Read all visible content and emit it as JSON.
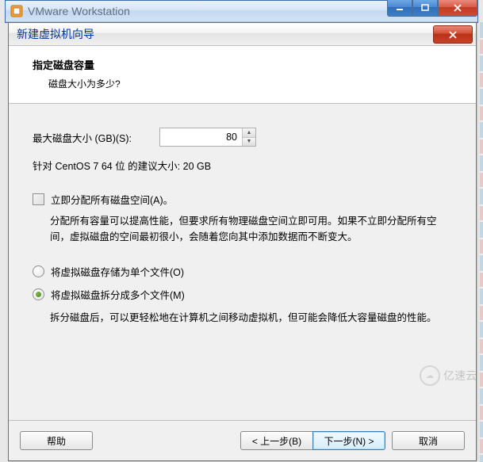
{
  "outer_window": {
    "title": "VMware Workstation"
  },
  "wizard": {
    "title": "新建虚拟机向导",
    "heading": "指定磁盘容量",
    "subheading": "磁盘大小为多少?"
  },
  "disk": {
    "label": "最大磁盘大小 (GB)(S):",
    "value": "80",
    "recommend": "针对 CentOS 7 64 位 的建议大小: 20 GB"
  },
  "allocate": {
    "checkbox_label": "立即分配所有磁盘空间(A)。",
    "checked": false,
    "desc": "分配所有容量可以提高性能，但要求所有物理磁盘空间立即可用。如果不立即分配所有空间，虚拟磁盘的空间最初很小，会随着您向其中添加数据而不断变大。"
  },
  "split": {
    "option_single": "将虚拟磁盘存储为单个文件(O)",
    "option_multi": "将虚拟磁盘拆分成多个文件(M)",
    "selected": "multi",
    "desc": "拆分磁盘后，可以更轻松地在计算机之间移动虚拟机，但可能会降低大容量磁盘的性能。"
  },
  "buttons": {
    "help": "帮助",
    "back": "< 上一步(B)",
    "next": "下一步(N) >",
    "cancel": "取消"
  },
  "watermark": "亿速云"
}
